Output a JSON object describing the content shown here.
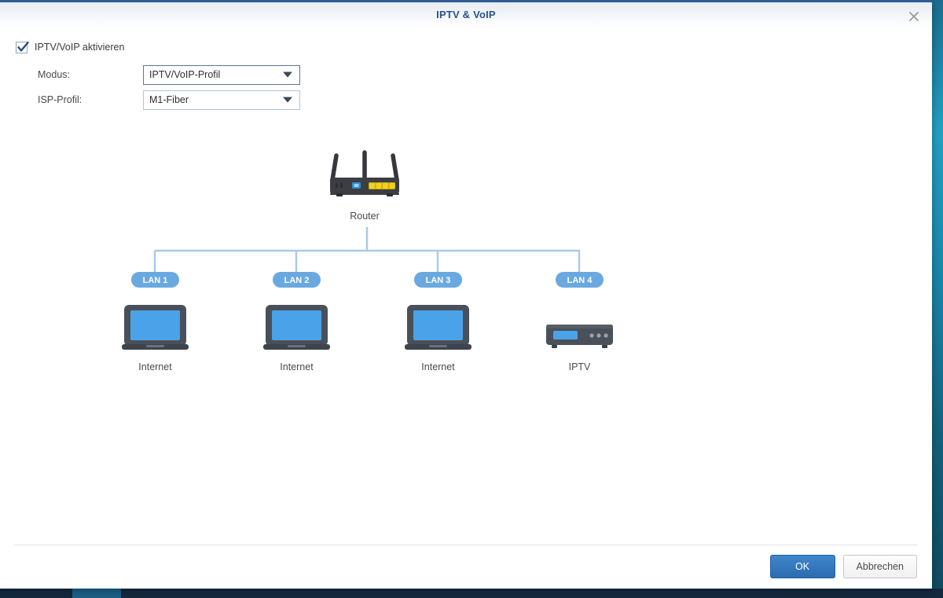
{
  "window": {
    "title": "IPTV & VoIP",
    "close_icon": "close-icon"
  },
  "form": {
    "enable_checkbox": {
      "label": "IPTV/VoIP aktivieren",
      "checked": true
    },
    "mode": {
      "label": "Modus:",
      "value": "IPTV/VoIP-Profil"
    },
    "isp_profile": {
      "label": "ISP-Profil:",
      "value": "M1-Fiber"
    }
  },
  "diagram": {
    "router": {
      "label": "Router",
      "icon": "router-icon"
    },
    "ports": [
      {
        "badge": "LAN 1",
        "device_label": "Internet",
        "device_icon": "laptop-icon"
      },
      {
        "badge": "LAN 2",
        "device_label": "Internet",
        "device_icon": "laptop-icon"
      },
      {
        "badge": "LAN 3",
        "device_label": "Internet",
        "device_icon": "laptop-icon"
      },
      {
        "badge": "LAN 4",
        "device_label": "IPTV",
        "device_icon": "set-top-box-icon"
      }
    ]
  },
  "footer": {
    "ok_label": "OK",
    "cancel_label": "Abbrechen"
  },
  "colors": {
    "title_text": "#27548c",
    "accent_blue": "#2c6cb0",
    "link_line": "#a9cbea",
    "badge_blue": "#6aa9e0",
    "device_screen": "#4aa3e8",
    "device_body": "#4a5059",
    "router_body": "#35373c",
    "port_yellow": "#f2d11a",
    "wan_blue": "#2d8fd5"
  }
}
